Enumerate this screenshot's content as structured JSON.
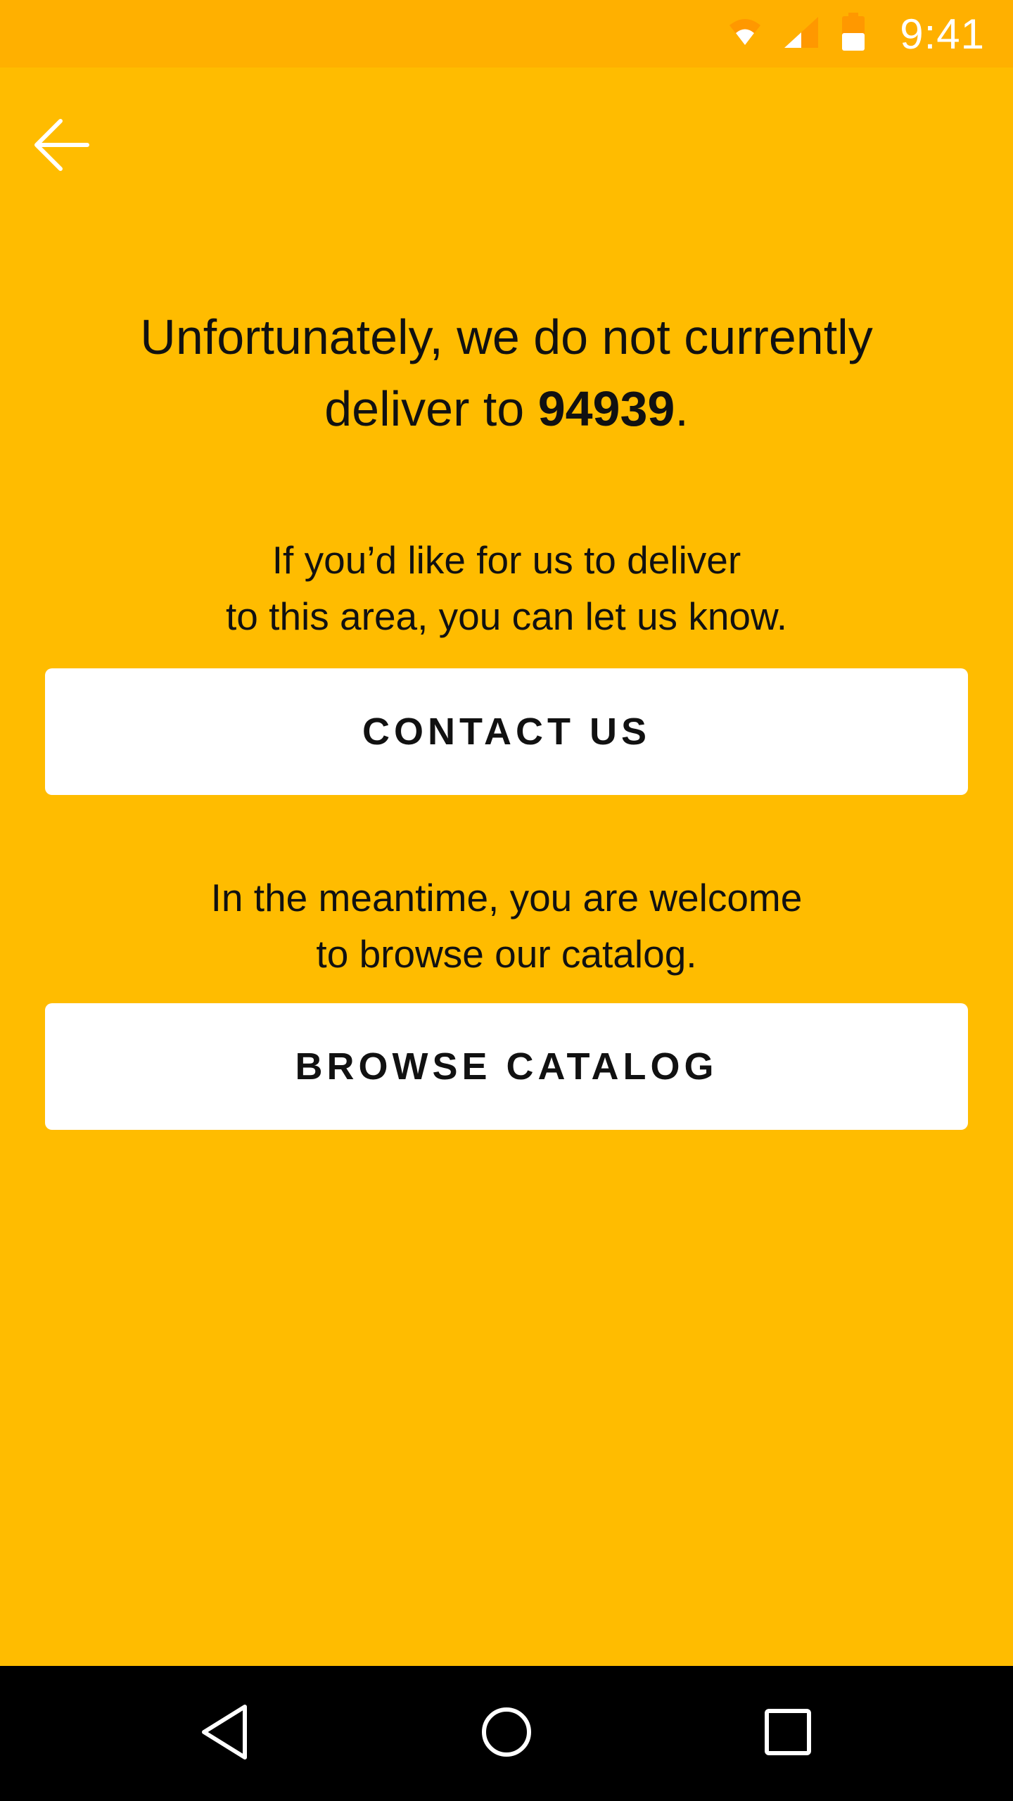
{
  "status_bar": {
    "time": "9:41",
    "icons": [
      "wifi-icon",
      "cellular-signal-icon",
      "battery-icon"
    ]
  },
  "header": {
    "back_icon": "arrow-left-icon"
  },
  "message": {
    "headline_prefix": "Unfortunately, we do not currently deliver to ",
    "zip_code": "94939",
    "headline_suffix": "."
  },
  "contact_section": {
    "text_line_1": "If you’d like for us to deliver",
    "text_line_2": "to this area, you can let us know.",
    "button_label": "CONTACT US"
  },
  "browse_section": {
    "text_line_1": "In the meantime, you are welcome",
    "text_line_2": "to browse our catalog.",
    "button_label": "BROWSE CATALOG"
  },
  "nav_bar": {
    "buttons": [
      "back-triangle-icon",
      "home-circle-icon",
      "recent-apps-square-icon"
    ]
  },
  "colors": {
    "background": "#FFBC00",
    "status_bar": "#FFB000",
    "button_background": "#FFFFFF",
    "text": "#111111",
    "nav_bar": "#000000"
  }
}
